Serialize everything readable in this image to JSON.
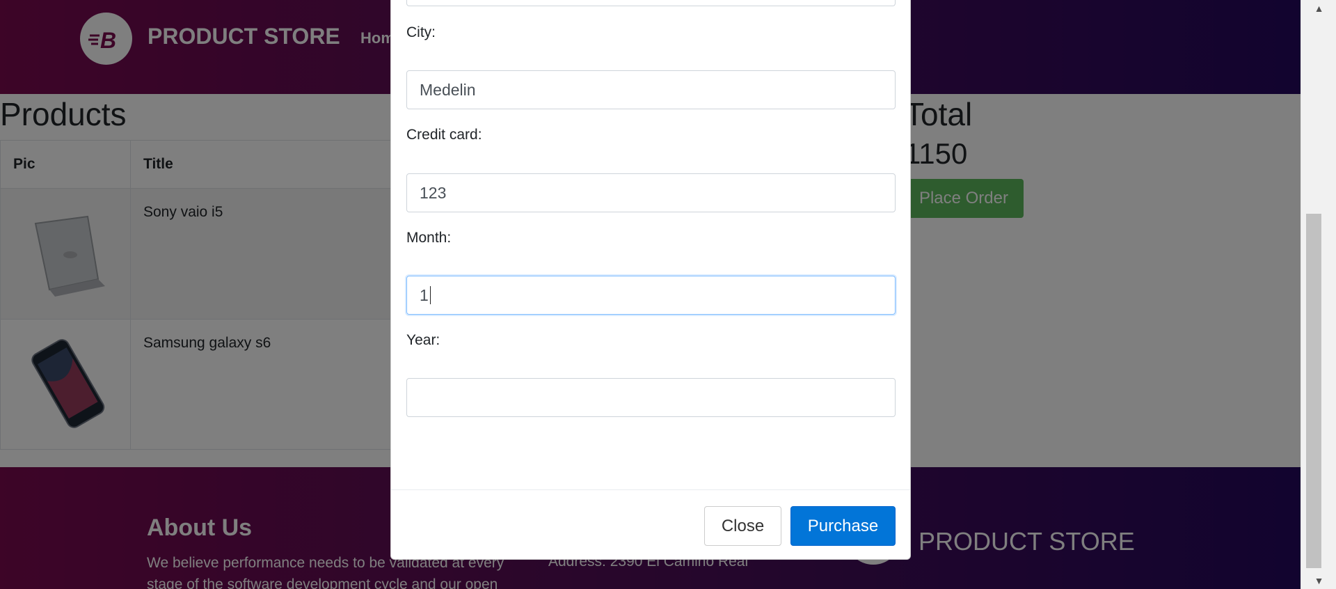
{
  "navbar": {
    "brand": "PRODUCT STORE",
    "home_link": "Hom"
  },
  "products": {
    "title": "Products",
    "headers": {
      "pic": "Pic",
      "title": "Title"
    },
    "rows": [
      {
        "name": "Sony vaio i5",
        "pic_icon": "laptop-image"
      },
      {
        "name": "Samsung galaxy s6",
        "pic_icon": "phone-image"
      }
    ]
  },
  "total": {
    "label": "Total",
    "value": "1150",
    "place_order": "Place Order"
  },
  "footer": {
    "about_title": "About Us",
    "about_text": "We believe performance needs to be validated at every stage of the software development cycle and our open",
    "address": "Address: 2390 El Camino Real",
    "brand": "PRODUCT STORE"
  },
  "modal": {
    "city_label": "City:",
    "city_value": "Medelin",
    "card_label": "Credit card:",
    "card_value": "123",
    "month_label": "Month:",
    "month_value": "1",
    "year_label": "Year:",
    "year_value": "",
    "close_label": "Close",
    "purchase_label": "Purchase"
  },
  "colors": {
    "nav_gradient_start": "#7a0a4f",
    "nav_gradient_end": "#24095e",
    "purchase_btn": "#0275d8",
    "place_order_btn": "#5cb85c"
  }
}
